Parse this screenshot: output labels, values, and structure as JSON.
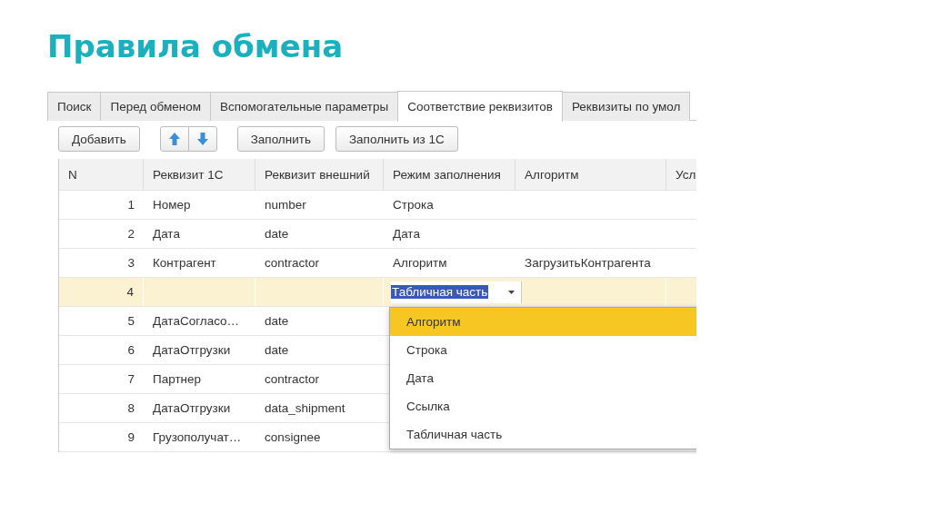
{
  "slide_title": "Правила обмена",
  "tabs": [
    {
      "label": "Поиск",
      "selected": false
    },
    {
      "label": "Перед обменом",
      "selected": false
    },
    {
      "label": "Вспомогательные параметры",
      "selected": false
    },
    {
      "label": "Соответствие реквизитов",
      "selected": true
    },
    {
      "label": "Реквизиты по умол",
      "selected": false
    }
  ],
  "toolbar": [
    {
      "kind": "button",
      "label": "Добавить"
    },
    {
      "kind": "arrows"
    },
    {
      "kind": "button",
      "label": "Заполнить"
    },
    {
      "kind": "button",
      "label": "Заполнить из 1С"
    }
  ],
  "table": {
    "columns": [
      "N",
      "Реквизит 1С",
      "Реквизит внешний",
      "Режим заполнения",
      "Алгоритм",
      "Усл"
    ],
    "rows": [
      {
        "selected": false,
        "cells": [
          "1",
          "Номер",
          "number",
          "Строка",
          ""
        ]
      },
      {
        "selected": false,
        "cells": [
          "2",
          "Дата",
          "date",
          "Дата",
          ""
        ]
      },
      {
        "selected": false,
        "cells": [
          "3",
          "Контрагент",
          "contractor",
          "Алгоритм",
          "ЗагрузитьКонтрагента"
        ]
      },
      {
        "selected": true,
        "cells": [
          "4",
          "",
          "",
          "",
          ""
        ],
        "editor": "Табличная часть"
      },
      {
        "selected": false,
        "cells": [
          "5",
          "ДатаСогласо…",
          "date",
          "",
          ""
        ]
      },
      {
        "selected": false,
        "cells": [
          "6",
          "ДатаОтгрузки",
          "date",
          "",
          ""
        ]
      },
      {
        "selected": false,
        "cells": [
          "7",
          "Партнер",
          "contractor",
          "",
          ""
        ]
      },
      {
        "selected": false,
        "cells": [
          "8",
          "ДатаОтгрузки",
          "data_shipment",
          "",
          ""
        ]
      },
      {
        "selected": false,
        "cells": [
          "9",
          "Грузополучат…",
          "consignee",
          "",
          ""
        ]
      }
    ]
  },
  "dropdown": [
    {
      "label": "Алгоритм",
      "selected": true
    },
    {
      "label": "Строка",
      "selected": false
    },
    {
      "label": "Дата",
      "selected": false
    },
    {
      "label": "Ссылка",
      "selected": false
    },
    {
      "label": "Табличная часть",
      "selected": false
    }
  ]
}
